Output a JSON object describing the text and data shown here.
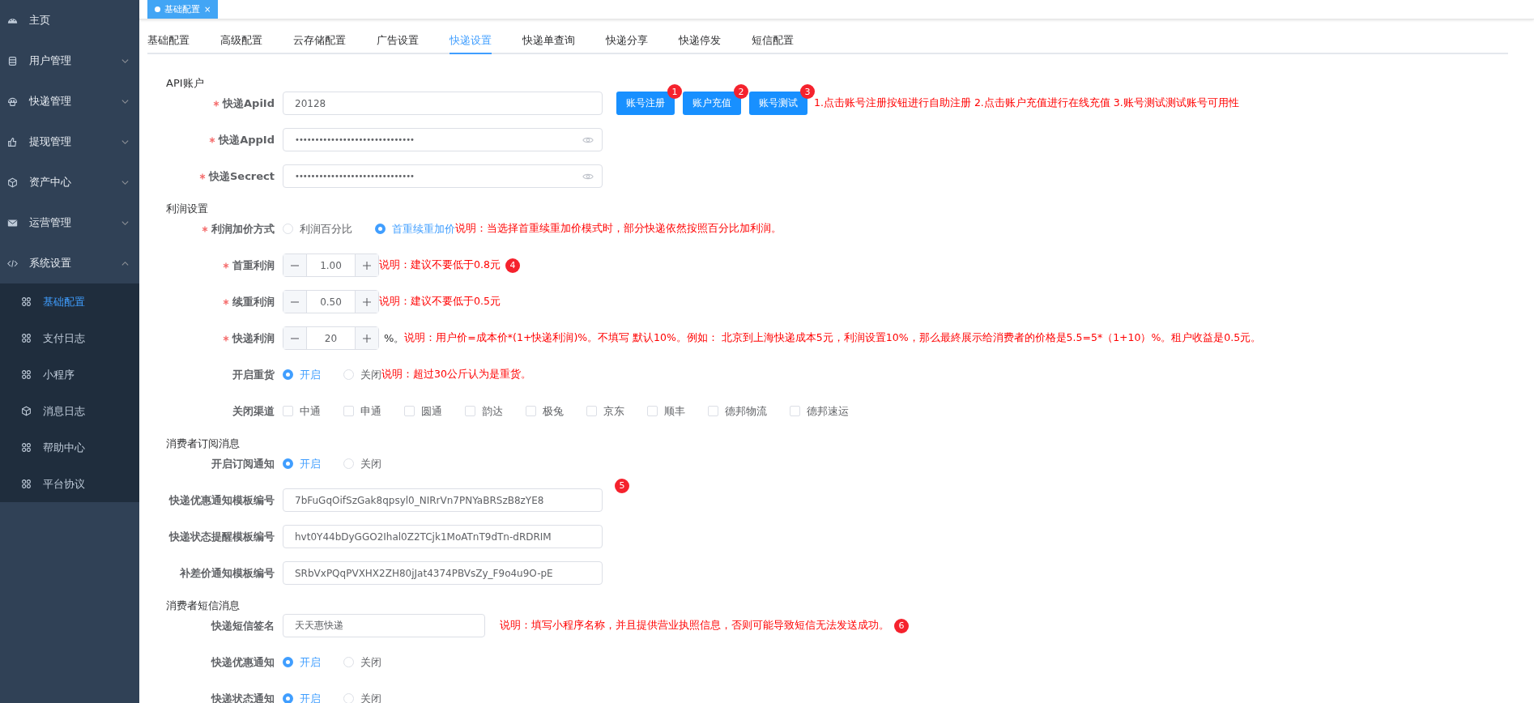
{
  "sidebar": {
    "items": [
      {
        "label": "主页"
      },
      {
        "label": "用户管理",
        "expanded": false
      },
      {
        "label": "快递管理",
        "expanded": false
      },
      {
        "label": "提现管理",
        "expanded": false
      },
      {
        "label": "资产中心",
        "expanded": false
      },
      {
        "label": "运营管理",
        "expanded": false
      },
      {
        "label": "系统设置",
        "expanded": true,
        "children": [
          {
            "label": "基础配置",
            "selected": true
          },
          {
            "label": "支付日志",
            "selected": false
          },
          {
            "label": "小程序",
            "selected": false
          },
          {
            "label": "消息日志",
            "selected": false
          },
          {
            "label": "帮助中心",
            "selected": false
          },
          {
            "label": "平台协议",
            "selected": false
          }
        ]
      }
    ]
  },
  "tags": [
    {
      "label": "基础配置",
      "close": "×",
      "selected": true
    }
  ],
  "tabs": [
    {
      "label": "基础配置",
      "selected": false
    },
    {
      "label": "高级配置",
      "selected": false
    },
    {
      "label": "云存储配置",
      "selected": false
    },
    {
      "label": "广告设置",
      "selected": false
    },
    {
      "label": "快递设置",
      "selected": true
    },
    {
      "label": "快递单查询",
      "selected": false
    },
    {
      "label": "快递分享",
      "selected": false
    },
    {
      "label": "快递停发",
      "selected": false
    },
    {
      "label": "短信配置",
      "selected": false
    }
  ],
  "sections": [
    {
      "title": "API账户",
      "rows": [
        {
          "kind": "input",
          "label": "快递ApiId",
          "required": true,
          "value": "20128",
          "buttons": [
            {
              "label": "账号注册",
              "marker": "1"
            },
            {
              "label": "账户充值",
              "marker": "2"
            },
            {
              "label": "账号测试",
              "marker": "3"
            }
          ],
          "note": "1.点击账号注册按钮进行自助注册 2.点击账户充值进行在线充值 3.账号测试测试账号可用性"
        },
        {
          "kind": "input",
          "label": "快递AppId",
          "required": true,
          "value": "••••••••••••••••••••••••••••••",
          "password": true
        },
        {
          "kind": "input",
          "label": "快递Secrect",
          "required": true,
          "value": "••••••••••••••••••••••••••••••",
          "password": true
        }
      ]
    },
    {
      "title": "利润设置",
      "rows": [
        {
          "kind": "radio",
          "label": "利润加价方式",
          "required": true,
          "options": [
            {
              "label": "利润百分比",
              "selected": false
            },
            {
              "label": "首重续重加价",
              "selected": true
            }
          ],
          "note": "说明：当选择首重续重加价模式时，部分快递依然按照百分比加利润。"
        },
        {
          "kind": "stepper",
          "label": "首重利润",
          "required": true,
          "value": "1.00",
          "note": "说明：建议不要低于0.8元",
          "marker": "4"
        },
        {
          "kind": "stepper",
          "label": "续重利润",
          "required": true,
          "value": "0.50",
          "note": "说明：建议不要低于0.5元"
        },
        {
          "kind": "stepper",
          "label": "快递利润",
          "required": true,
          "value": "20",
          "suffix": "%。",
          "note": "说明：用户价=成本价*(1+快递利润)%。不填写 默认10%。例如： 北京到上海快递成本5元，利润设置10%，那么最終展示给消费者的价格是5.5=5*（1+10）%。租户收益是0.5元。"
        },
        {
          "kind": "radio",
          "label": "开启重货",
          "options": [
            {
              "label": "开启",
              "selected": true
            },
            {
              "label": "关闭",
              "selected": false
            }
          ],
          "note": "说明：超过30公斤认为是重货。"
        },
        {
          "kind": "checkbox",
          "label": "关闭渠道",
          "options": [
            {
              "label": "中通",
              "checked": false
            },
            {
              "label": "申通",
              "checked": false
            },
            {
              "label": "圆通",
              "checked": false
            },
            {
              "label": "韵达",
              "checked": false
            },
            {
              "label": "极兔",
              "checked": false
            },
            {
              "label": "京东",
              "checked": false
            },
            {
              "label": "顺丰",
              "checked": false
            },
            {
              "label": "德邦物流",
              "checked": false
            },
            {
              "label": "德邦速运",
              "checked": false
            }
          ]
        }
      ]
    },
    {
      "title": "消费者订阅消息",
      "rows": [
        {
          "kind": "radio",
          "label": "开启订阅通知",
          "options": [
            {
              "label": "开启",
              "selected": true
            },
            {
              "label": "关闭",
              "selected": false
            }
          ]
        },
        {
          "kind": "input",
          "label": "快递优惠通知模板编号",
          "value": "7bFuGqOifSzGak8qpsyl0_NIRrVn7PNYaBRSzB8zYE8",
          "marker": "5"
        },
        {
          "kind": "input",
          "label": "快递状态提醒模板编号",
          "value": "hvt0Y44bDyGGO2Ihal0Z2TCjk1MoATnT9dTn-dRDRIM"
        },
        {
          "kind": "input",
          "label": "补差价通知模板编号",
          "value": "SRbVxPQqPVXHX2ZH80jJat4374PBVsZy_F9o4u9O-pE"
        }
      ]
    },
    {
      "title": "消费者短信消息",
      "rows": [
        {
          "kind": "short_input",
          "label": "快递短信签名",
          "value": "天天惠快递",
          "note": "说明：填写小程序名称，并且提供营业执照信息，否则可能导致短信无法发送成功。",
          "marker": "6"
        },
        {
          "kind": "radio",
          "label": "快递优惠通知",
          "options": [
            {
              "label": "开启",
              "selected": true
            },
            {
              "label": "关闭",
              "selected": false
            }
          ]
        },
        {
          "kind": "radio",
          "label": "快递状态通知",
          "options": [
            {
              "label": "开启",
              "selected": true
            },
            {
              "label": "关闭",
              "selected": false
            }
          ]
        }
      ]
    }
  ]
}
